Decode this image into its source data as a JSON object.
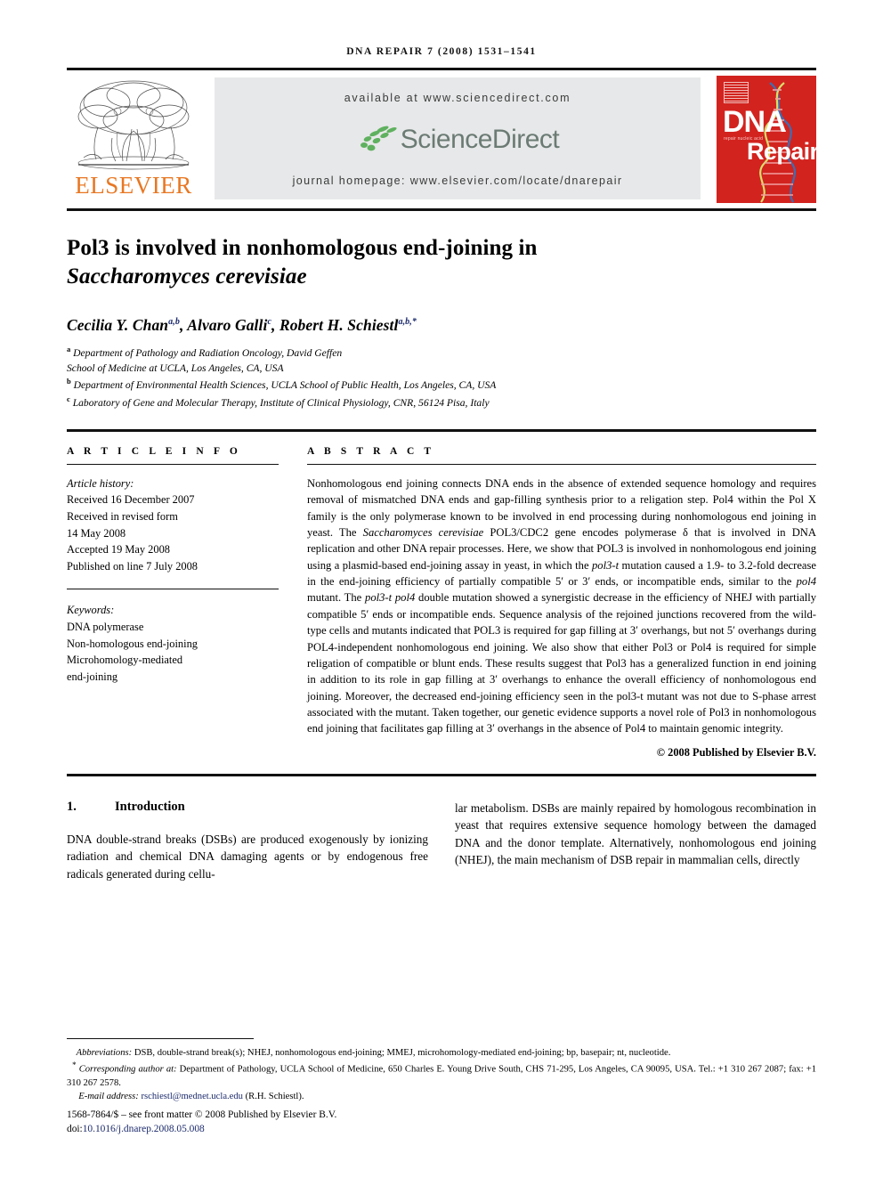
{
  "running_head": {
    "journal": "DNA REPAIR",
    "citation": "7 (2008) 1531–1541"
  },
  "banner": {
    "publisher": "ELSEVIER",
    "available_at": "available at www.sciencedirect.com",
    "sciencedirect_word": "ScienceDirect",
    "journal_homepage": "journal homepage: www.elsevier.com/locate/dnarepair",
    "cover": {
      "line1": "DNA",
      "line2": "Repair",
      "tagline": "repair nucleic acid"
    },
    "colors": {
      "elsevier_orange": "#E87722",
      "cover_red": "#d2231f",
      "sd_green": "#5fb15f",
      "sd_gray": "#6b7b74",
      "banner_gray": "#e7e8e9"
    }
  },
  "article": {
    "title_line1": "Pol3 is involved in nonhomologous end-joining in",
    "title_line2_italic": "Saccharomyces cerevisiae",
    "authors": [
      {
        "name": "Cecilia Y. Chan",
        "sup": "a,b"
      },
      {
        "name": "Alvaro Galli",
        "sup": "c"
      },
      {
        "name": "Robert H. Schiestl",
        "sup": "a,b,*"
      }
    ],
    "affiliations": [
      {
        "marker": "a",
        "text": "Department of Pathology and Radiation Oncology, David Geffen"
      },
      {
        "marker": "",
        "text": "School of Medicine at UCLA, Los Angeles, CA, USA"
      },
      {
        "marker": "b",
        "text": "Department of Environmental Health Sciences, UCLA School of Public Health, Los Angeles, CA, USA"
      },
      {
        "marker": "c",
        "text": "Laboratory of Gene and Molecular Therapy, Institute of Clinical Physiology, CNR, 56124 Pisa, Italy"
      }
    ]
  },
  "info": {
    "heading": "A R T I C L E   I N F O",
    "history_label": "Article history:",
    "history": [
      "Received 16 December 2007",
      "Received in revised form",
      "14 May 2008",
      "Accepted 19 May 2008",
      "Published on line 7 July 2008"
    ],
    "keywords_label": "Keywords:",
    "keywords": [
      "DNA polymerase",
      "Non-homologous end-joining",
      "Microhomology-mediated",
      "end-joining"
    ]
  },
  "abstract": {
    "heading": "A B S T R A C T",
    "paragraph_1": "Nonhomologous end joining connects DNA ends in the absence of extended sequence homology and requires removal of mismatched DNA ends and gap-filling synthesis prior to a religation step. Pol4 within the Pol X family is the only polymerase known to be involved in end processing during nonhomologous end joining in yeast. The ",
    "italic_1": "Saccharomyces cerevisiae",
    "paragraph_2": " POL3/CDC2 gene encodes polymerase δ that is involved in DNA replication and other DNA repair processes. Here, we show that POL3 is involved in nonhomologous end joining using a plasmid-based end-joining assay in yeast, in which the ",
    "italic_2": "pol3-t",
    "paragraph_3": " mutation caused a 1.9- to 3.2-fold decrease in the end-joining efficiency of partially compatible 5′ or 3′ ends, or incompatible ends, similar to the ",
    "italic_3": "pol4",
    "paragraph_4": " mutant. The ",
    "italic_4": "pol3-t pol4",
    "paragraph_5": " double mutation showed a synergistic decrease in the efficiency of NHEJ with partially compatible 5′ ends or incompatible ends. Sequence analysis of the rejoined junctions recovered from the wild-type cells and mutants indicated that POL3 is required for gap filling at 3′ overhangs, but not 5′ overhangs during POL4-independent nonhomologous end joining. We also show that either Pol3 or Pol4 is required for simple religation of compatible or blunt ends. These results suggest that Pol3 has a generalized function in end joining in addition to its role in gap filling at 3′ overhangs to enhance the overall efficiency of nonhomologous end joining. Moreover, the decreased end-joining efficiency seen in the pol3-t mutant was not due to S-phase arrest associated with the mutant. Taken together, our genetic evidence supports a novel role of Pol3 in nonhomologous end joining that facilitates gap filling at 3′ overhangs in the absence of Pol4 to maintain genomic integrity.",
    "copyright": "© 2008 Published by Elsevier B.V."
  },
  "body": {
    "section_number": "1.",
    "section_title": "Introduction",
    "left_paragraph": "DNA double-strand breaks (DSBs) are produced exogenously by ionizing radiation and chemical DNA damaging agents or by endogenous free radicals generated during cellu-",
    "right_paragraph": "lar metabolism. DSBs are mainly repaired by homologous recombination in yeast that requires extensive sequence homology between the damaged DNA and the donor template. Alternatively, nonhomologous end joining (NHEJ), the main mechanism of DSB repair in mammalian cells, directly"
  },
  "footnotes": {
    "abbreviations_label": "Abbreviations:",
    "abbreviations_text": " DSB, double-strand break(s); NHEJ, nonhomologous end-joining; MMEJ, microhomology-mediated end-joining; bp, basepair; nt, nucleotide.",
    "corresponding_label": "Corresponding author at:",
    "corresponding_text": " Department of Pathology, UCLA School of Medicine, 650 Charles E. Young Drive South, CHS 71-295, Los Angeles, CA 90095, USA. Tel.: +1 310 267 2087; fax: +1 310 267 2578.",
    "email_label": "E-mail address:",
    "email": "rschiestl@mednet.ucla.edu",
    "email_suffix": " (R.H. Schiestl).",
    "issn_line": "1568-7864/$ – see front matter © 2008 Published by Elsevier B.V.",
    "doi_label": "doi:",
    "doi": "10.1016/j.dnarep.2008.05.008"
  }
}
